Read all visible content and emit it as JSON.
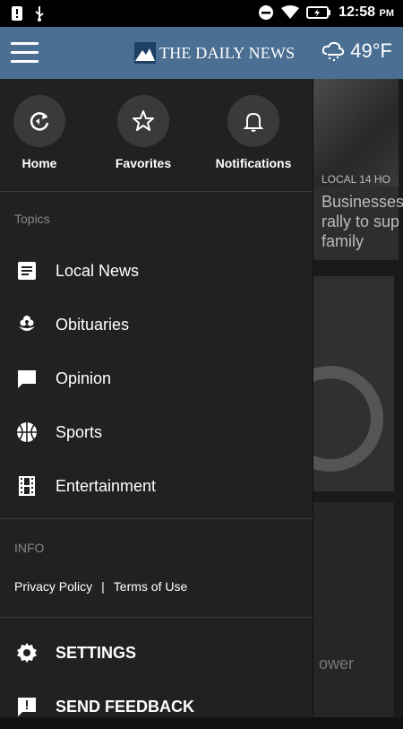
{
  "status_bar": {
    "time": "12:58",
    "ampm": "PM"
  },
  "app_bar": {
    "logo_text": "THE DAILY NEWS",
    "temperature": "49°F"
  },
  "quick_links": [
    {
      "label": "Home",
      "icon": "home-refresh-icon"
    },
    {
      "label": "Favorites",
      "icon": "star-icon"
    },
    {
      "label": "Notifications",
      "icon": "bell-icon"
    }
  ],
  "topics": {
    "title": "Topics",
    "items": [
      {
        "label": "Local News",
        "icon": "article-icon"
      },
      {
        "label": "Obituaries",
        "icon": "flower-icon"
      },
      {
        "label": "Opinion",
        "icon": "comment-icon"
      },
      {
        "label": "Sports",
        "icon": "basketball-icon"
      },
      {
        "label": "Entertainment",
        "icon": "film-icon"
      }
    ]
  },
  "info": {
    "title": "INFO",
    "privacy_label": "Privacy Policy",
    "separator": "|",
    "terms_label": "Terms of Use"
  },
  "actions": {
    "settings_label": "SETTINGS",
    "feedback_label": "SEND FEEDBACK"
  },
  "background_cards": {
    "card1_kicker": "LOCAL 14 HO",
    "card1_title_line1": "Businesses",
    "card1_title_line2": "rally to sup",
    "card1_title_line3": "family",
    "card3_title": "ower"
  },
  "colors": {
    "app_bar": "#4a6f93",
    "drawer": "#212121"
  }
}
